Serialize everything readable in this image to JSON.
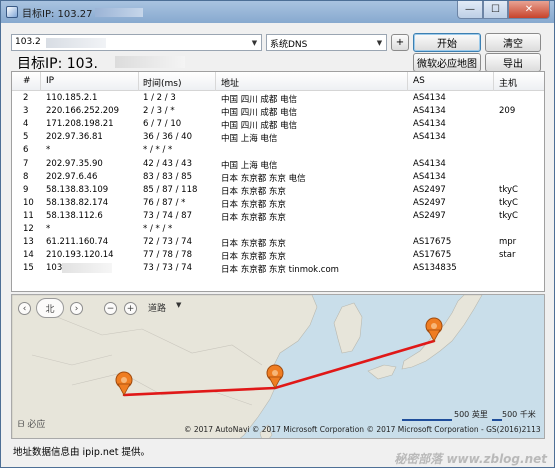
{
  "window": {
    "title_prefix": "目标IP: 103.27",
    "controls": {
      "minimize": "—",
      "maximize": "☐",
      "close": "✕"
    }
  },
  "toolbar": {
    "ip_value": "103.2",
    "dns_value": "系统DNS",
    "add_label": "+",
    "start_label": "开始",
    "clear_label": "清空",
    "bing_map_label": "微软必应地图",
    "export_label": "导出"
  },
  "target_label": "目标IP:  103.",
  "table": {
    "headers": [
      "#",
      "IP",
      "时间(ms)",
      "地址",
      "AS",
      "主机"
    ],
    "rows": [
      {
        "num": "2",
        "ip": "110.185.2.1",
        "time": "1 / 2 / 3",
        "addr": "中国 四川 成都 电信",
        "as": "AS4134",
        "host": ""
      },
      {
        "num": "3",
        "ip": "220.166.252.209",
        "time": "2 / 3 / *",
        "addr": "中国 四川 成都 电信",
        "as": "AS4134",
        "host": "209"
      },
      {
        "num": "4",
        "ip": "171.208.198.21",
        "time": "6 / 7 / 10",
        "addr": "中国 四川 成都 电信",
        "as": "AS4134",
        "host": ""
      },
      {
        "num": "5",
        "ip": "202.97.36.81",
        "time": "36 / 36 / 40",
        "addr": "中国 上海 电信",
        "as": "AS4134",
        "host": ""
      },
      {
        "num": "6",
        "ip": "*",
        "time": "* / * / *",
        "addr": "",
        "as": "",
        "host": ""
      },
      {
        "num": "7",
        "ip": "202.97.35.90",
        "time": "42 / 43 / 43",
        "addr": "中国 上海 电信",
        "as": "AS4134",
        "host": ""
      },
      {
        "num": "8",
        "ip": "202.97.6.46",
        "time": "83 / 83 / 85",
        "addr": "日本 东京都 东京 电信",
        "as": "AS4134",
        "host": ""
      },
      {
        "num": "9",
        "ip": "58.138.83.109",
        "time": "85 / 87 / 118",
        "addr": "日本 东京都 东京",
        "as": "AS2497",
        "host": "tkyC"
      },
      {
        "num": "10",
        "ip": "58.138.82.174",
        "time": "76 / 87 / *",
        "addr": "日本 东京都 东京",
        "as": "AS2497",
        "host": "tkyC"
      },
      {
        "num": "11",
        "ip": "58.138.112.6",
        "time": "73 / 74 / 87",
        "addr": "日本 东京都 东京",
        "as": "AS2497",
        "host": "tkyC"
      },
      {
        "num": "12",
        "ip": "*",
        "time": "* / * / *",
        "addr": "",
        "as": "",
        "host": ""
      },
      {
        "num": "13",
        "ip": "61.211.160.74",
        "time": "72 / 73 / 74",
        "addr": "日本 东京都 东京",
        "as": "AS17675",
        "host": "mpr"
      },
      {
        "num": "14",
        "ip": "210.193.120.14",
        "time": "77 / 78 / 78",
        "addr": "日本 东京都 东京",
        "as": "AS17675",
        "host": "star"
      },
      {
        "num": "15",
        "ip": "103.",
        "time": "73 / 73 / 74",
        "addr": "日本 东京都 东京 tinmok.com",
        "as": "AS134835",
        "host": ""
      }
    ]
  },
  "map": {
    "road_label": "道路",
    "bing_label": "必应",
    "scale_miles": "500 英里",
    "scale_km": "500 千米",
    "copyright": "© 2017 AutoNavi   © 2017 Microsoft Corporation   © 2017 Microsoft Corporation - GS(2016)2113",
    "route_color": "#e01818",
    "land_color": "#e8e6dc",
    "water_color": "#c9deea"
  },
  "status": "地址数据信息由 ipip.net 提供。",
  "watermark": "秘密部落 www.zblog.net"
}
